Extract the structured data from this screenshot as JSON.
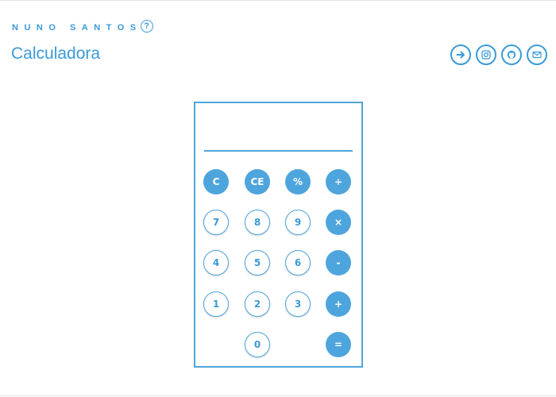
{
  "header": {
    "brand": "NUNO SANTOS",
    "help_icon": "?",
    "title": "Calculadora"
  },
  "social": [
    {
      "name": "arrow-right-icon"
    },
    {
      "name": "instagram-icon"
    },
    {
      "name": "github-icon"
    },
    {
      "name": "mail-icon"
    }
  ],
  "calculator": {
    "display": "",
    "keys": {
      "clear": "C",
      "clear_entry": "CE",
      "percent": "%",
      "divide": "÷",
      "seven": "7",
      "eight": "8",
      "nine": "9",
      "multiply": "×",
      "four": "4",
      "five": "5",
      "six": "6",
      "minus": "-",
      "one": "1",
      "two": "2",
      "three": "3",
      "plus": "+",
      "zero": "0",
      "equals": "="
    }
  },
  "colors": {
    "accent": "#3a9ad9",
    "key_fill": "#4ea5dd",
    "background": "#ffffff"
  }
}
